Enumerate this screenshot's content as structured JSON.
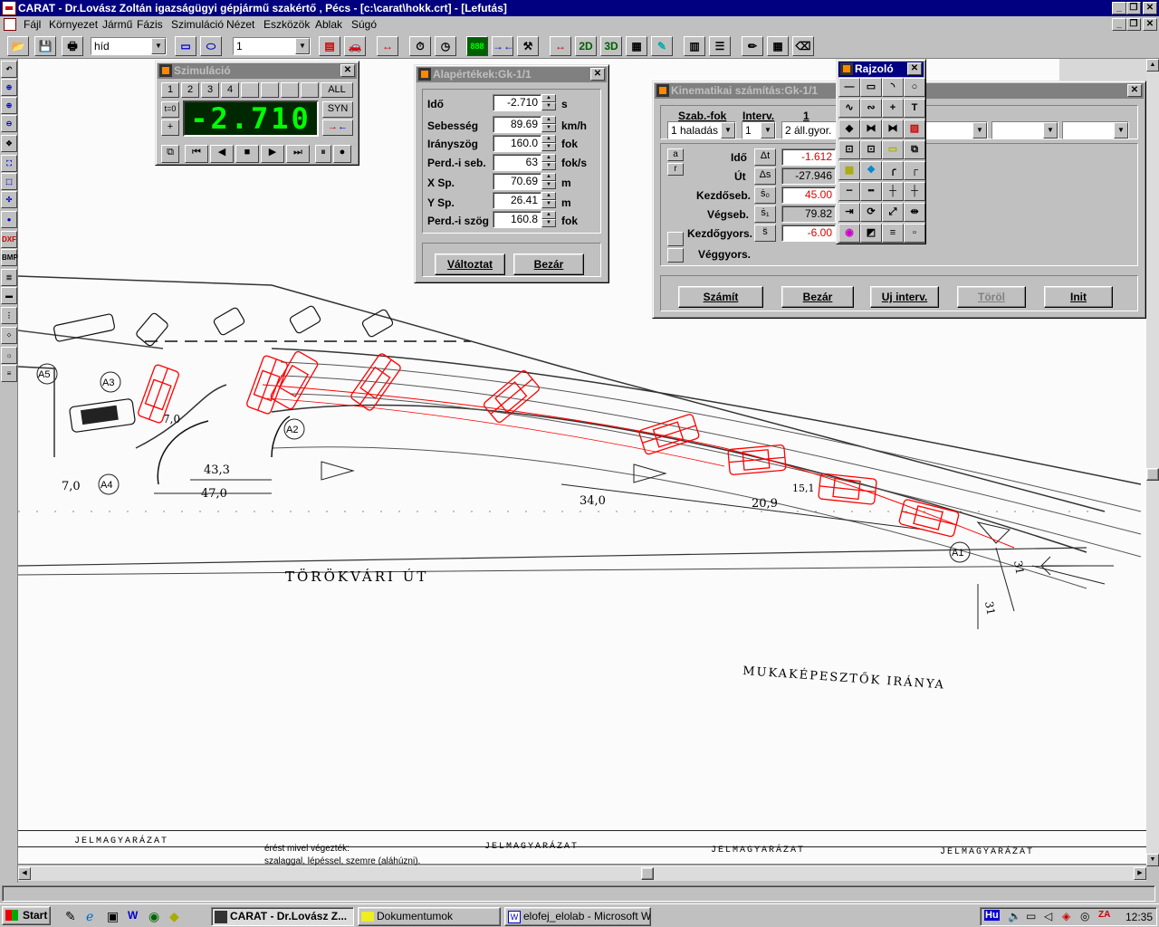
{
  "app": {
    "title": "CARAT - Dr.Lovász Zoltán igazságügyi gépjármű szakértő , Pécs - [c:\\carat\\hokk.crt] - [Lefutás]"
  },
  "menu": [
    "Fájl",
    "Környezet",
    "Jármű",
    "Fázis",
    "Szimuláció",
    "Nézet",
    "Eszközök",
    "Ablak",
    "Súgó"
  ],
  "toolbar": {
    "combo1": "híd",
    "combo2": "1",
    "btn_2d": "2D",
    "btn_3d": "3D"
  },
  "lefttool": {
    "dxf": "DXF",
    "bmp": "BMP"
  },
  "sim": {
    "title": "Szimuláció",
    "phases": [
      "1",
      "2",
      "3",
      "4"
    ],
    "all": "ALL",
    "t0": "t=0",
    "display": "-2.710",
    "syn": "SYN"
  },
  "initial": {
    "title": "Alapértékek:Gk-1/1",
    "rows": [
      {
        "label": "Idő",
        "value": "-2.710",
        "unit": "s"
      },
      {
        "label": "Sebesség",
        "value": "89.69",
        "unit": "km/h"
      },
      {
        "label": "Irányszög",
        "value": "160.0",
        "unit": "fok"
      },
      {
        "label": "Perd.-i seb.",
        "value": "63",
        "unit": "fok/s"
      },
      {
        "label": "X Sp.",
        "value": "70.69",
        "unit": "m"
      },
      {
        "label": "Y Sp.",
        "value": "26.41",
        "unit": "m"
      },
      {
        "label": "Perd.-i szög",
        "value": "160.8",
        "unit": "fok"
      }
    ],
    "btn_change": "Változtat",
    "btn_close": "Bezár"
  },
  "kin": {
    "title": "Kinematikai számítás:Gk-1/1",
    "col_dof": "Szab.-fok",
    "col_interv": "Interv.",
    "col_1": "1",
    "dof_value": "1 haladás",
    "interv_value": "1",
    "mode_value": "2 áll.gyor.",
    "btn_a": "a",
    "btn_r": "r",
    "rows": [
      {
        "label": "Idő",
        "sym": "Δt",
        "value": "-1.612",
        "red": true
      },
      {
        "label": "Út",
        "sym": "Δs",
        "value": "-27.946",
        "red": false
      },
      {
        "label": "Kezdőseb.",
        "sym": "ṡ₀",
        "value": "45.00",
        "red": true
      },
      {
        "label": "Végseb.",
        "sym": "ṡ₁",
        "value": "79.82",
        "red": false
      },
      {
        "label": "Kezdőgyors.",
        "sym": "s̈",
        "value": "-6.00",
        "red": true
      },
      {
        "label": "Véggyors.",
        "sym": "",
        "value": "",
        "red": false
      }
    ],
    "btn_calc": "Számít",
    "btn_close": "Bezár",
    "btn_new": "Uj interv.",
    "btn_delete": "Töröl",
    "btn_init": "Init"
  },
  "draw": {
    "title": "Rajzoló",
    "text_tool": "T"
  },
  "drawing": {
    "labels": [
      "TÖRÖKVÁRI ÚT",
      "MUKAKÉPESZTŐK IRÁNYA",
      "43,3",
      "47,0",
      "7,0",
      "34,0",
      "20,9",
      "15,1",
      "31",
      "31",
      "7,0"
    ],
    "legend": [
      "JELMAGYARÁZAT",
      "JELMAGYARÁZAT",
      "JELMAGYARÁZAT",
      "JELMAGYARÁZAT"
    ],
    "legend_note1": "érést mivel végezték:",
    "legend_note2": "szalaggal, lépéssel, szemre (aláhúzni).",
    "circles": [
      "A5",
      "A3",
      "A4",
      "A2",
      "A1"
    ]
  },
  "taskbar": {
    "start": "Start",
    "tasks": [
      "CARAT - Dr.Lovász Z...",
      "Dokumentumok",
      "elofej_elolab - Microsoft W..."
    ],
    "lang": "Hu",
    "clock": "12:35"
  },
  "colors": {
    "car": "#ff0000",
    "title_active": "#000080",
    "lcd": "#00ff00"
  }
}
